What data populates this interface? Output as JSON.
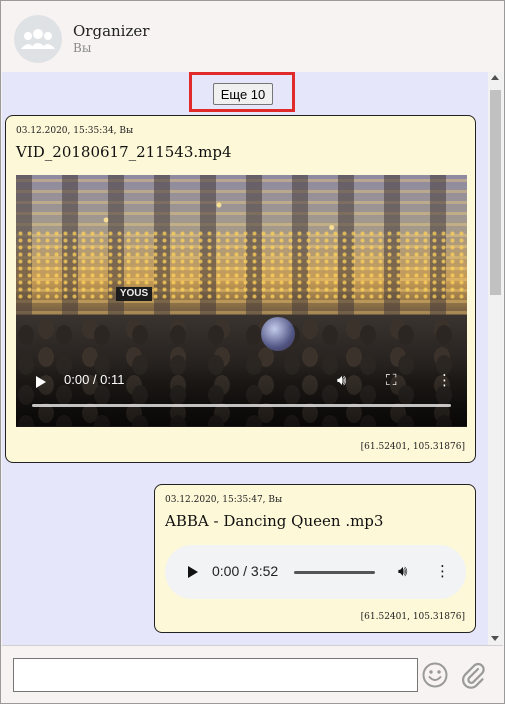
{
  "header": {
    "title": "Organizer",
    "subtitle": "Вы",
    "avatar_icon": "group-icon"
  },
  "load_more": {
    "label": "Еще 10",
    "highlight_color": "#e12a2a"
  },
  "messages": [
    {
      "meta": "03.12.2020, 15:35:34, Вы",
      "file_name": "VID_20180617_211543.mp4",
      "type": "video",
      "player": {
        "time": "0:00 / 0:11",
        "progress": 0,
        "icons": [
          "play-icon",
          "volume-icon",
          "fullscreen-icon",
          "more-options-icon"
        ],
        "shop_sign": "YOUS"
      },
      "coords": "[61.52401, 105.31876]"
    },
    {
      "meta": "03.12.2020, 15:35:47, Вы",
      "file_name": "ABBA - Dancing Queen .mp3",
      "type": "audio",
      "player": {
        "time": "0:00 / 3:52",
        "progress": 0,
        "icons": [
          "play-icon",
          "volume-icon",
          "more-options-icon"
        ]
      },
      "coords": "[61.52401, 105.31876]"
    }
  ],
  "composer": {
    "value": "",
    "placeholder": "",
    "icons": [
      "emoji-icon",
      "attach-icon"
    ]
  },
  "colors": {
    "chat_background": "#e6e6fa",
    "bubble_background": "#fdf8d8",
    "header_background": "#f7f3f3"
  }
}
